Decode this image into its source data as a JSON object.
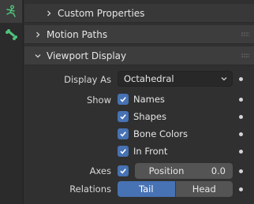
{
  "sidebar": {
    "tabs": [
      {
        "icon": "armature-object-icon",
        "active": true
      },
      {
        "icon": "bone-data-icon",
        "active": false
      }
    ]
  },
  "panels": {
    "custom_properties": {
      "label": "Custom Properties",
      "expanded": false
    },
    "motion_paths": {
      "label": "Motion Paths",
      "expanded": false
    },
    "viewport_display": {
      "label": "Viewport Display",
      "expanded": true
    }
  },
  "viewport_display": {
    "display_as": {
      "label": "Display As",
      "value": "Octahedral"
    },
    "show": {
      "label": "Show",
      "options": [
        {
          "label": "Names",
          "checked": true
        },
        {
          "label": "Shapes",
          "checked": true
        },
        {
          "label": "Bone Colors",
          "checked": true
        },
        {
          "label": "In Front",
          "checked": true
        }
      ]
    },
    "axes": {
      "label": "Axes",
      "checked": true,
      "position_label": "Position",
      "position_value": "0.0"
    },
    "relations": {
      "label": "Relations",
      "options": [
        "Tail",
        "Head"
      ],
      "selected": "Tail"
    }
  },
  "colors": {
    "accent": "#4772b3",
    "panel_bg": "#303030",
    "header_bg": "#3d3d3d"
  }
}
